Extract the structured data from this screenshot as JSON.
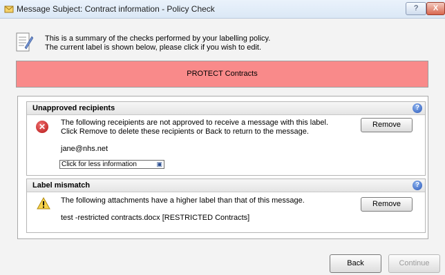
{
  "window": {
    "title": "Message Subject: Contract information - Policy Check",
    "help_button": "?",
    "close_button": "X"
  },
  "summary": {
    "line1": "This is a summary of the checks performed by your labelling policy.",
    "line2": "The current label is shown below, please click if you wish to edit."
  },
  "label": {
    "text": "PROTECT Contracts",
    "color": "#f98a8a"
  },
  "sections": [
    {
      "title": "Unapproved recipients",
      "icon": "error-icon",
      "message_line1": "The following receipients are not approved to receive a message with this label.",
      "message_line2": "Click Remove to delete these recipients or Back to return to the message.",
      "item": "jane@nhs.net",
      "link": "Click for less information",
      "button": "Remove"
    },
    {
      "title": "Label mismatch",
      "icon": "warning-icon",
      "message_line1": "The following attachments have a higher label than that of this message.",
      "item": "test -restricted contracts.docx [RESTRICTED Contracts]",
      "button": "Remove"
    }
  ],
  "footer": {
    "back": "Back",
    "continue": "Continue"
  }
}
